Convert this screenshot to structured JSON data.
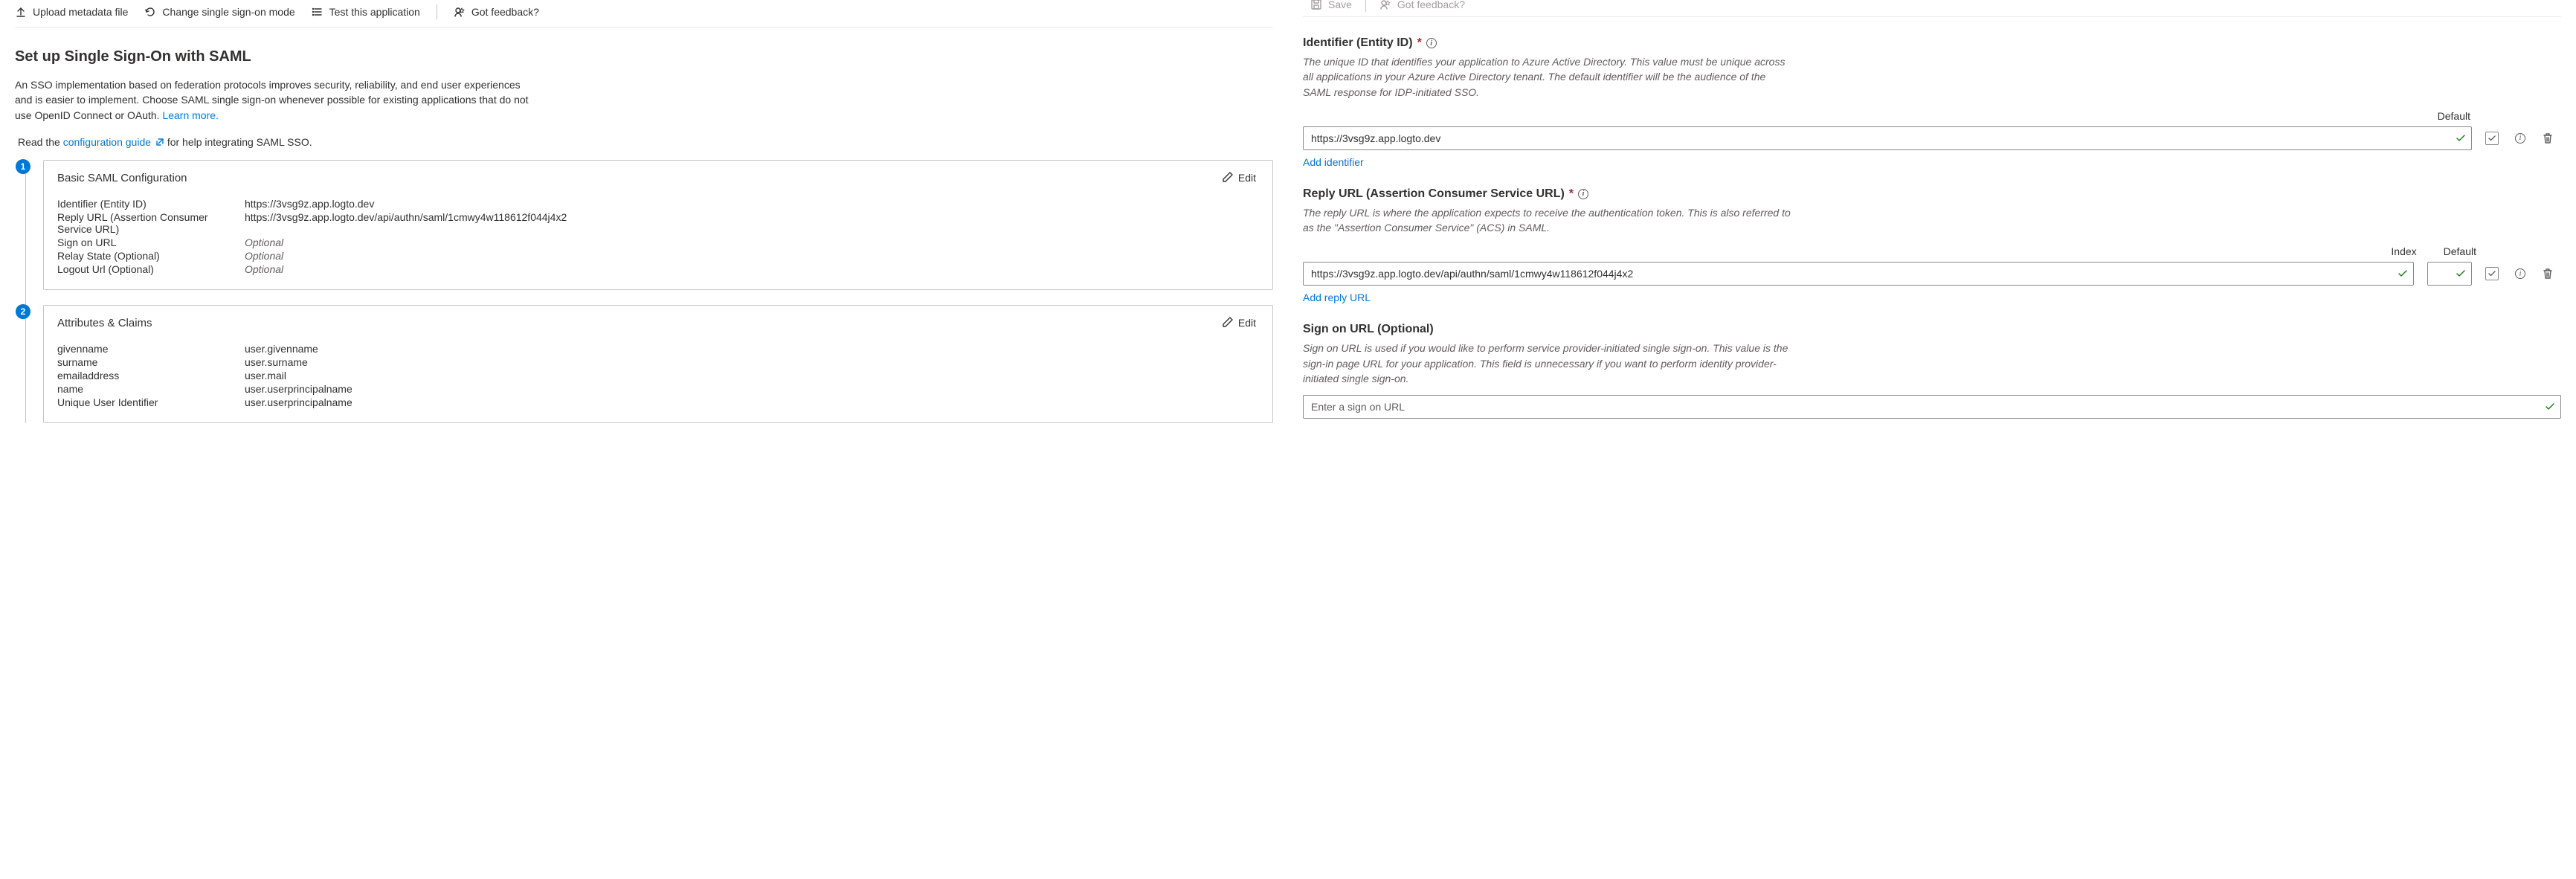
{
  "left": {
    "toolbar": {
      "upload": "Upload metadata file",
      "change_mode": "Change single sign-on mode",
      "test": "Test this application",
      "feedback": "Got feedback?"
    },
    "heading": "Set up Single Sign-On with SAML",
    "description": "An SSO implementation based on federation protocols improves security, reliability, and end user experiences and is easier to implement. Choose SAML single sign-on whenever possible for existing applications that do not use OpenID Connect or OAuth. ",
    "learn_more": "Learn more.",
    "read_prefix": "Read the ",
    "config_guide": "configuration guide",
    "read_suffix": " for help integrating SAML SSO.",
    "edit_label": "Edit",
    "card1": {
      "num": "1",
      "title": "Basic SAML Configuration",
      "rows": [
        {
          "k": "Identifier (Entity ID)",
          "v": "https://3vsg9z.app.logto.dev",
          "optional": false
        },
        {
          "k": "Reply URL (Assertion Consumer Service URL)",
          "v": "https://3vsg9z.app.logto.dev/api/authn/saml/1cmwy4w118612f044j4x2",
          "optional": false
        },
        {
          "k": "Sign on URL",
          "v": "Optional",
          "optional": true
        },
        {
          "k": "Relay State (Optional)",
          "v": "Optional",
          "optional": true
        },
        {
          "k": "Logout Url (Optional)",
          "v": "Optional",
          "optional": true
        }
      ]
    },
    "card2": {
      "num": "2",
      "title": "Attributes & Claims",
      "rows": [
        {
          "k": "givenname",
          "v": "user.givenname"
        },
        {
          "k": "surname",
          "v": "user.surname"
        },
        {
          "k": "emailaddress",
          "v": "user.mail"
        },
        {
          "k": "name",
          "v": "user.userprincipalname"
        },
        {
          "k": "Unique User Identifier",
          "v": "user.userprincipalname"
        }
      ]
    }
  },
  "right": {
    "toolbar": {
      "save": "Save",
      "feedback": "Got feedback?"
    },
    "identifier": {
      "title": "Identifier (Entity ID)",
      "help": "The unique ID that identifies your application to Azure Active Directory. This value must be unique across all applications in your Azure Active Directory tenant. The default identifier will be the audience of the SAML response for IDP-initiated SSO.",
      "col_default": "Default",
      "value": "https://3vsg9z.app.logto.dev",
      "add": "Add identifier"
    },
    "reply": {
      "title": "Reply URL (Assertion Consumer Service URL)",
      "help": "The reply URL is where the application expects to receive the authentication token. This is also referred to as the \"Assertion Consumer Service\" (ACS) in SAML.",
      "col_index": "Index",
      "col_default": "Default",
      "value": "https://3vsg9z.app.logto.dev/api/authn/saml/1cmwy4w118612f044j4x2",
      "add": "Add reply URL"
    },
    "signon": {
      "title": "Sign on URL (Optional)",
      "help": "Sign on URL is used if you would like to perform service provider-initiated single sign-on. This value is the sign-in page URL for your application. This field is unnecessary if you want to perform identity provider-initiated single sign-on.",
      "placeholder": "Enter a sign on URL"
    }
  }
}
